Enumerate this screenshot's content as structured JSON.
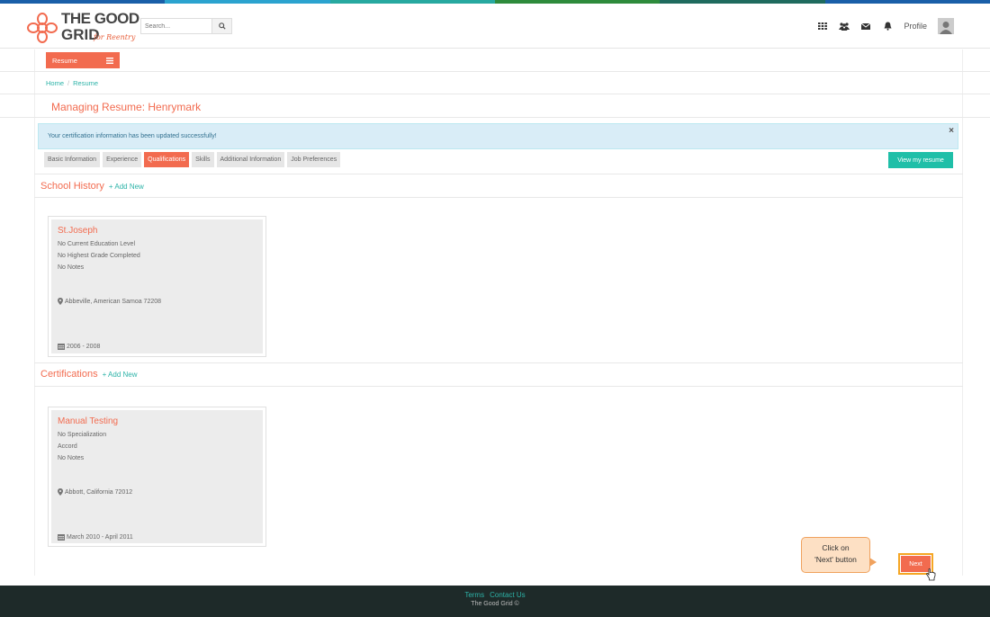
{
  "brand": {
    "logo_line1": "THE GOOD",
    "logo_line2": "GRID",
    "logo_tagline": "for Reentry",
    "stripe_colors": [
      "#1a5fa8",
      "#2ba3cf",
      "#27a9a0",
      "#2e8b3c",
      "#1f6b5e",
      "#1a5fa8"
    ]
  },
  "header": {
    "search_placeholder": "Search...",
    "profile_label": "Profile",
    "icons": [
      "grid-icon",
      "users-icon",
      "envelope-icon",
      "bell-icon",
      "avatar-icon"
    ]
  },
  "menu": {
    "resume_label": "Resume"
  },
  "breadcrumb": {
    "home": "Home",
    "separator": "/",
    "current": "Resume"
  },
  "page_title": "Managing Resume: Henrymark",
  "alert": {
    "message": "Your certification information has been updated successfully!",
    "close": "×"
  },
  "tabs": [
    {
      "label": "Basic Information",
      "active": false
    },
    {
      "label": "Experience",
      "active": false
    },
    {
      "label": "Qualifications",
      "active": true
    },
    {
      "label": "Skills",
      "active": false
    },
    {
      "label": "Additional Information",
      "active": false
    },
    {
      "label": "Job Preferences",
      "active": false
    }
  ],
  "view_resume_label": "View my resume",
  "school_history": {
    "title": "School History",
    "add_label": "+ Add New",
    "cards": [
      {
        "name": "St.Joseph",
        "lines": [
          "No Current Education Level",
          "No Highest Grade Completed",
          "No Notes"
        ],
        "location": "Abbeville, American Samoa 72208",
        "dates": "2006 - 2008"
      }
    ]
  },
  "certifications": {
    "title": "Certifications",
    "add_label": "+ Add New",
    "cards": [
      {
        "name": "Manual Testing",
        "lines": [
          "No Specialization",
          "Accord",
          "No Notes"
        ],
        "location": "Abbott, California 72012",
        "dates": "March 2010 - April 2011"
      }
    ]
  },
  "callout": {
    "line1": "Click on",
    "line2": "'Next' button"
  },
  "next_label": "Next",
  "footer": {
    "terms": "Terms",
    "contact": "Contact Us",
    "copyright": "The Good Grid ©"
  },
  "colors": {
    "accent": "#f26b4f",
    "teal": "#1fbfa8",
    "footer_bg": "#1e2a29"
  }
}
